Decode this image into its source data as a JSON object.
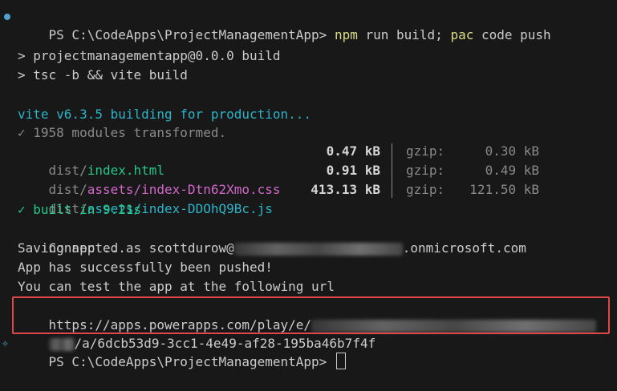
{
  "prompt": {
    "ps": "PS C:\\CodeApps\\ProjectManagementApp> ",
    "cmd_npm": "npm",
    "cmd_args1": " run build; ",
    "cmd_pac": "pac",
    "cmd_args2": " code push"
  },
  "build": {
    "script_line": "> projectmanagementapp@0.0.0 build",
    "tsc_line": "> tsc -b && vite build"
  },
  "vite": {
    "building": "vite v6.3.5 building for production...",
    "modules": "✓ 1958 modules transformed.",
    "files": [
      {
        "dir": "dist/",
        "name": "index.html",
        "name_color": "green",
        "size": "0.47 kB",
        "gzip_label": "gzip:",
        "gzip": "0.30 kB"
      },
      {
        "dir": "dist/",
        "name": "assets/index-Dtn62Xmo.css",
        "name_color": "magenta",
        "size": "0.91 kB",
        "gzip_label": "gzip:",
        "gzip": "0.49 kB"
      },
      {
        "dir": "dist/",
        "name": "assets/index-DDOhQ9Bc.js",
        "name_color": "cyan",
        "size": "413.13 kB",
        "gzip_label": "gzip:",
        "gzip": "121.50 kB"
      }
    ],
    "built": "✓ built in 9.21s"
  },
  "push": {
    "connected_prefix": "Connected as scottdurow@",
    "connected_suffix": ".onmicrosoft.com",
    "saving": "Saving app ...",
    "success": "App has successfully been pushed!",
    "test_hint": "You can test the app at the following url",
    "url_part1": "https://apps.powerapps.com/play/e/",
    "url_part2": "/a/6dcb53d9-3cc1-4e49-af28-195ba46b7f4f"
  },
  "final_prompt": "PS C:\\CodeApps\\ProjectManagementApp> ",
  "colors": {
    "background": "#181818",
    "text": "#cccccc",
    "command": "#dcdc8b",
    "vite": "#2bb3c8",
    "success": "#23c88a",
    "dim": "#8a8a8a",
    "highlight_border": "#e04848",
    "status_dot": "#4fa3d1"
  },
  "icons": {
    "status": "circle-dot-icon",
    "gutter": "sparkle-icon"
  }
}
